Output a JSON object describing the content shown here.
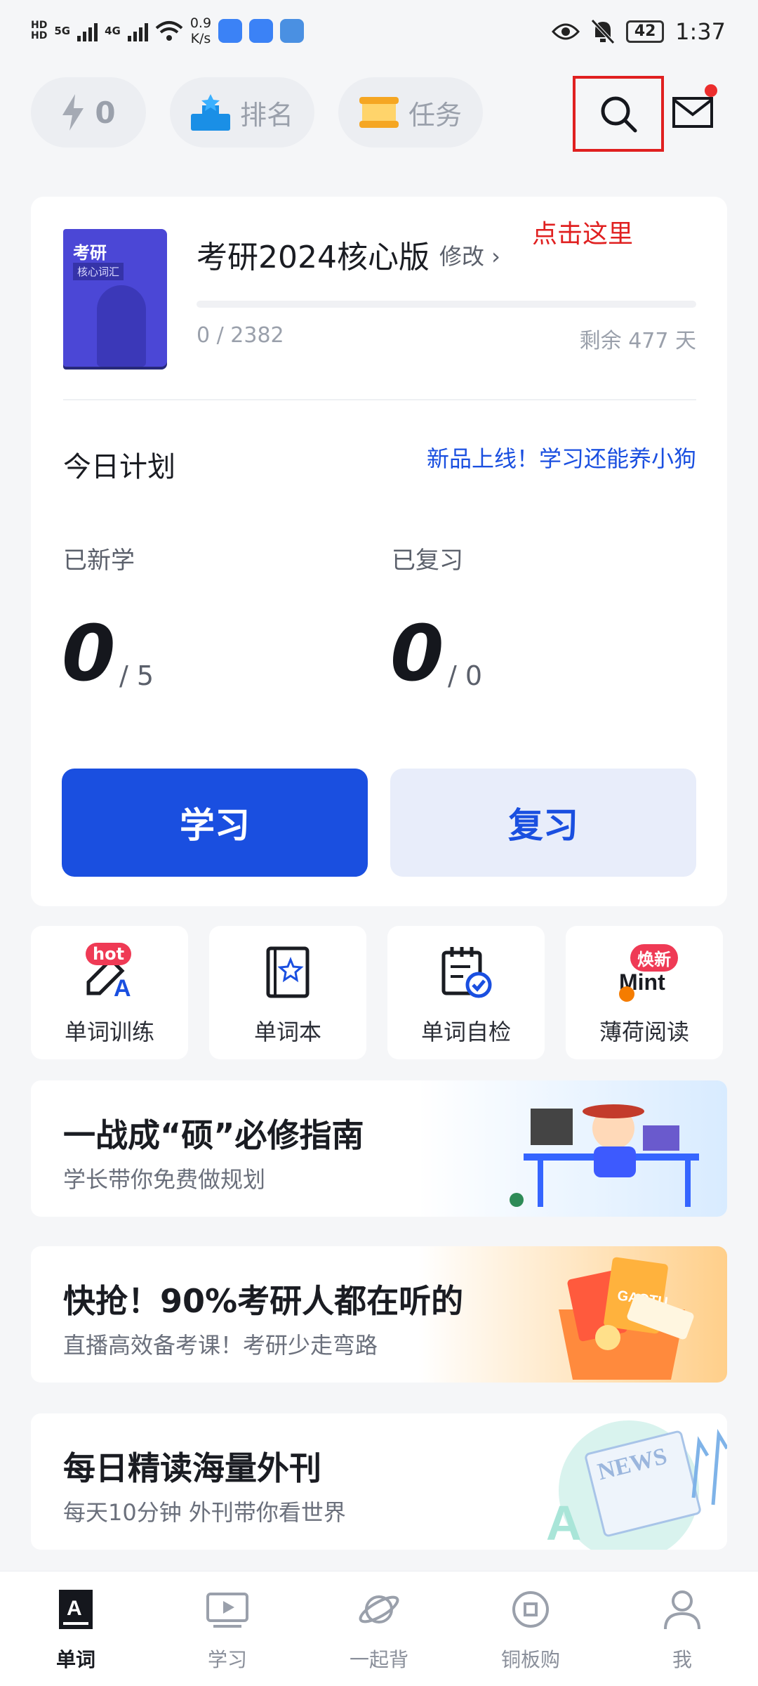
{
  "status_bar": {
    "net1": "5G",
    "net2": "4G",
    "speed_value": "0.9",
    "speed_unit": "K/s",
    "battery": "42",
    "time": "1:37"
  },
  "top_bar": {
    "energy_count": "0",
    "rank_label": "排名",
    "task_label": "任务"
  },
  "annotation": "点击这里",
  "plan": {
    "book_cover_line1": "考研",
    "book_cover_line2": "核心词汇",
    "book_title": "考研2024核心版",
    "edit_label": "修改 ›",
    "progress_text": "0 / 2382",
    "progress_fraction": 0,
    "remaining_text": "剩余 477 天",
    "today_title": "今日计划",
    "promo_link": "新品上线！学习还能养小狗",
    "new_label": "已新学",
    "new_count": "0",
    "new_target": "/ 5",
    "review_label": "已复习",
    "review_count": "0",
    "review_target": "/ 0",
    "learn_button": "学习",
    "review_button": "复习"
  },
  "tools": [
    {
      "label": "单词训练",
      "badge": "hot",
      "icon": "pen-a-icon"
    },
    {
      "label": "单词本",
      "icon": "star-book-icon"
    },
    {
      "label": "单词自检",
      "icon": "calendar-check-icon"
    },
    {
      "label": "薄荷阅读",
      "badge": "焕新",
      "logo_text": "Mint",
      "icon": "mint-logo"
    }
  ],
  "banners": [
    {
      "title": "一战成“硕”必修指南",
      "subtitle": "学长带你免费做规划"
    },
    {
      "title": "快抢！90%考研人都在听的",
      "subtitle": "直播高效备考课！考研少走弯路",
      "art_text": "GAOTU"
    },
    {
      "title": "每日精读海量外刊",
      "subtitle": "每天10分钟 外刊带你看世界",
      "art_text": "NEWS"
    }
  ],
  "tabs": [
    {
      "label": "单词",
      "active": true
    },
    {
      "label": "学习"
    },
    {
      "label": "一起背"
    },
    {
      "label": "铜板购"
    },
    {
      "label": "我"
    }
  ],
  "colors": {
    "primary": "#1a4fe0",
    "annotation_red": "#e02020",
    "background": "#f5f6f8"
  }
}
